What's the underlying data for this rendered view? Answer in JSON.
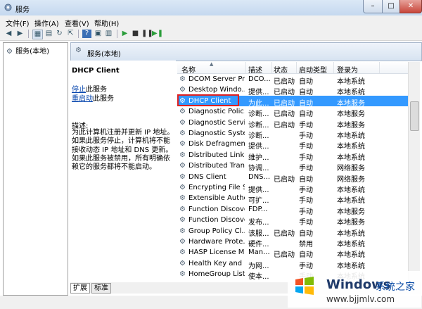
{
  "window": {
    "title": "服务"
  },
  "menu": [
    "文件(F)",
    "操作(A)",
    "查看(V)",
    "帮助(H)"
  ],
  "toolbar_icons": [
    "back-icon",
    "forward-icon",
    "console-tree-icon",
    "view-icon",
    "refresh-icon",
    "export-icon",
    "help-icon",
    "properties-icon",
    "start-icon",
    "stop-icon",
    "pause-icon",
    "restart-icon"
  ],
  "tree": {
    "node": "服务(本地)"
  },
  "header": {
    "title": "服务(本地)"
  },
  "detail": {
    "service_name": "DHCP Client",
    "stop_link": "停止",
    "stop_suffix": "此服务",
    "restart_link": "重启动",
    "restart_suffix": "此服务",
    "desc_label": "描述:",
    "desc_text": "为此计算机注册并更新 IP 地址。如果此服务停止，计算机将不能接收动态 IP 地址和 DNS 更新。如果此服务被禁用，所有明确依赖它的服务都将不能启动。"
  },
  "columns": [
    "名称",
    "描述",
    "状态",
    "启动类型",
    "登录为"
  ],
  "rows": [
    {
      "name": "DCOM Server Pr...",
      "desc": "DCO...",
      "state": "已启动",
      "start": "自动",
      "login": "本地系统"
    },
    {
      "name": "Desktop Windo...",
      "desc": "提供...",
      "state": "已启动",
      "start": "自动",
      "login": "本地系统"
    },
    {
      "name": "DHCP Client",
      "desc": "为此...",
      "state": "已启动",
      "start": "自动",
      "login": "本地服务"
    },
    {
      "name": "Diagnostic Polic...",
      "desc": "诊断...",
      "state": "已启动",
      "start": "自动",
      "login": "本地服务"
    },
    {
      "name": "Diagnostic Servi...",
      "desc": "诊断...",
      "state": "已启动",
      "start": "手动",
      "login": "本地服务"
    },
    {
      "name": "Diagnostic Syste...",
      "desc": "诊断...",
      "state": "",
      "start": "手动",
      "login": "本地系统"
    },
    {
      "name": "Disk Defragmen...",
      "desc": "提供...",
      "state": "",
      "start": "手动",
      "login": "本地系统"
    },
    {
      "name": "Distributed Link ...",
      "desc": "维护...",
      "state": "",
      "start": "手动",
      "login": "本地系统"
    },
    {
      "name": "Distributed Tran...",
      "desc": "协调...",
      "state": "",
      "start": "手动",
      "login": "网络服务"
    },
    {
      "name": "DNS Client",
      "desc": "DNS...",
      "state": "已启动",
      "start": "自动",
      "login": "网络服务"
    },
    {
      "name": "Encrypting File S...",
      "desc": "提供...",
      "state": "",
      "start": "手动",
      "login": "本地系统"
    },
    {
      "name": "Extensible Authe...",
      "desc": "可扩...",
      "state": "",
      "start": "手动",
      "login": "本地系统"
    },
    {
      "name": "Function Discove...",
      "desc": "FDP...",
      "state": "",
      "start": "手动",
      "login": "本地服务"
    },
    {
      "name": "Function Discove...",
      "desc": "发布...",
      "state": "",
      "start": "手动",
      "login": "本地服务"
    },
    {
      "name": "Group Policy Cl...",
      "desc": "该服...",
      "state": "已启动",
      "start": "自动",
      "login": "本地系统"
    },
    {
      "name": "Hardware Prote...",
      "desc": "硬件...",
      "state": "",
      "start": "禁用",
      "login": "本地系统"
    },
    {
      "name": "HASP License M...",
      "desc": "Man...",
      "state": "已启动",
      "start": "自动",
      "login": "本地系统"
    },
    {
      "name": "Health Key and ...",
      "desc": "为网...",
      "state": "",
      "start": "手动",
      "login": "本地系统"
    },
    {
      "name": "HomeGroup List...",
      "desc": "使本...",
      "state": "",
      "start": "手动",
      "login": "本地系统"
    }
  ],
  "selected_row": 2,
  "tabs": [
    "扩展",
    "标准"
  ],
  "watermark": {
    "brand": "Windows",
    "brand_cn": "系统之家",
    "url": "www.bjjmlv.com"
  }
}
